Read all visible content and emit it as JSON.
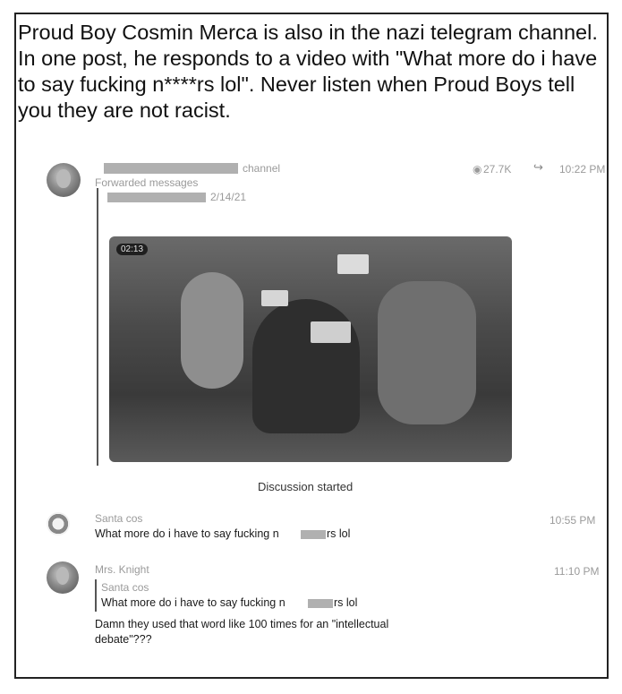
{
  "headline": "Proud Boy Cosmin Merca is also in the nazi telegram channel. In one post, he responds to a video with \"What more do i have to say fucking n****rs lol\". Never listen when Proud Boys tell you they are not racist.",
  "post": {
    "channel_suffix": "channel",
    "forwarded_label": "Forwarded messages",
    "views": "27.7K",
    "time": "10:22 PM",
    "forwarded_date": "2/14/21",
    "video_duration": "02:13",
    "discussion_label": "Discussion started"
  },
  "comments": [
    {
      "author": "Santa cos",
      "time": "10:55 PM",
      "text": "What more do i  have to say fucking n",
      "text_end": "rs lol"
    },
    {
      "author": "Mrs. Knight",
      "time": "11:10 PM",
      "reply_author": "Santa cos",
      "reply_text": "What more do i  have to say fucking n",
      "reply_text_end": "rs lol",
      "text_line1": "Damn they used that word like 100 times for an \"intellectual",
      "text_line2": "debate\"???"
    }
  ]
}
